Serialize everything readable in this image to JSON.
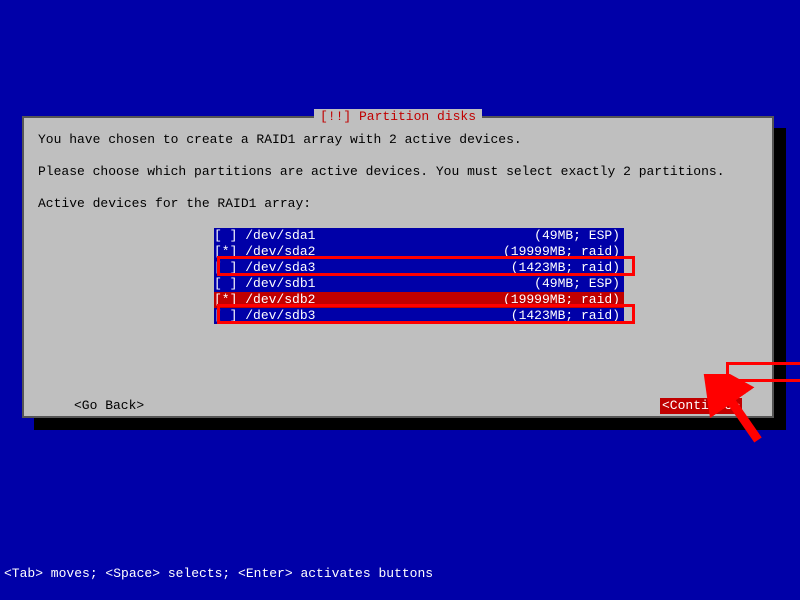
{
  "dialog": {
    "title": "[!!] Partition disks",
    "line1": "You have chosen to create a RAID1 array with 2 active devices.",
    "line2": "Please choose which partitions are active devices. You must select exactly 2 partitions.",
    "line3": "Active devices for the RAID1 array:"
  },
  "partitions": [
    {
      "mark": "[ ] ",
      "dev": "/dev/sda1",
      "info": "(49MB; ESP)",
      "selected": false
    },
    {
      "mark": "[*] ",
      "dev": "/dev/sda2",
      "info": "(19999MB; raid)",
      "selected": true
    },
    {
      "mark": "[ ] ",
      "dev": "/dev/sda3",
      "info": "(1423MB; raid)",
      "selected": false
    },
    {
      "mark": "[ ] ",
      "dev": "/dev/sdb1",
      "info": "(49MB; ESP)",
      "selected": false
    },
    {
      "mark": "[*] ",
      "dev": "/dev/sdb2",
      "info": "(19999MB; raid)",
      "selected": true
    },
    {
      "mark": "[ ] ",
      "dev": "/dev/sdb3",
      "info": "(1423MB; raid)",
      "selected": false
    }
  ],
  "buttons": {
    "back": "<Go Back>",
    "cont": "<Continue>"
  },
  "helpbar": "<Tab> moves; <Space> selects; <Enter> activates buttons"
}
